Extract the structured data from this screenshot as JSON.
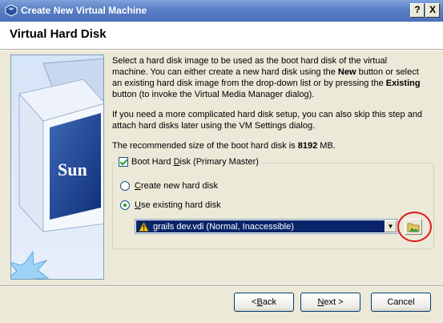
{
  "window": {
    "title": "Create New Virtual Machine",
    "help_btn": "?",
    "close_btn": "X"
  },
  "page": {
    "heading": "Virtual Hard Disk"
  },
  "intro": {
    "p1_a": "Select a hard disk image to be used as the boot hard disk of the virtual machine. You can either create a new hard disk using the ",
    "p1_new": "New",
    "p1_b": " button or select an existing hard disk image from the drop-down list or by pressing the ",
    "p1_existing": "Existing",
    "p1_c": " button (to invoke the Virtual Media Manager dialog).",
    "p2": "If you need a more complicated hard disk setup, you can also skip this step and attach hard disks later using the VM Settings dialog.",
    "p3_a": "The recommended size of the boot hard disk is ",
    "p3_size": "8192",
    "p3_b": " MB."
  },
  "boot_group": {
    "label_pre": "Boot Hard ",
    "label_u": "D",
    "label_post": "isk (Primary Master)",
    "checked": true,
    "create_u": "C",
    "create_rest": "reate new hard disk",
    "use_u": "U",
    "use_rest": "se existing hard disk",
    "selected_option": "use_existing",
    "disk_value": "grails dev.vdi (Normal, Inaccessible)",
    "warning_icon": "warning-icon",
    "folder_icon": "folder-icon"
  },
  "sidebar_brand": "Sun",
  "buttons": {
    "back_pre": "< ",
    "back_u": "B",
    "back_post": "ack",
    "next_u": "N",
    "next_post": "ext >",
    "cancel": "Cancel"
  },
  "colors": {
    "selection": "#0a246a",
    "highlight_circle": "#e0161b",
    "titlebar": "#4a70bb"
  }
}
